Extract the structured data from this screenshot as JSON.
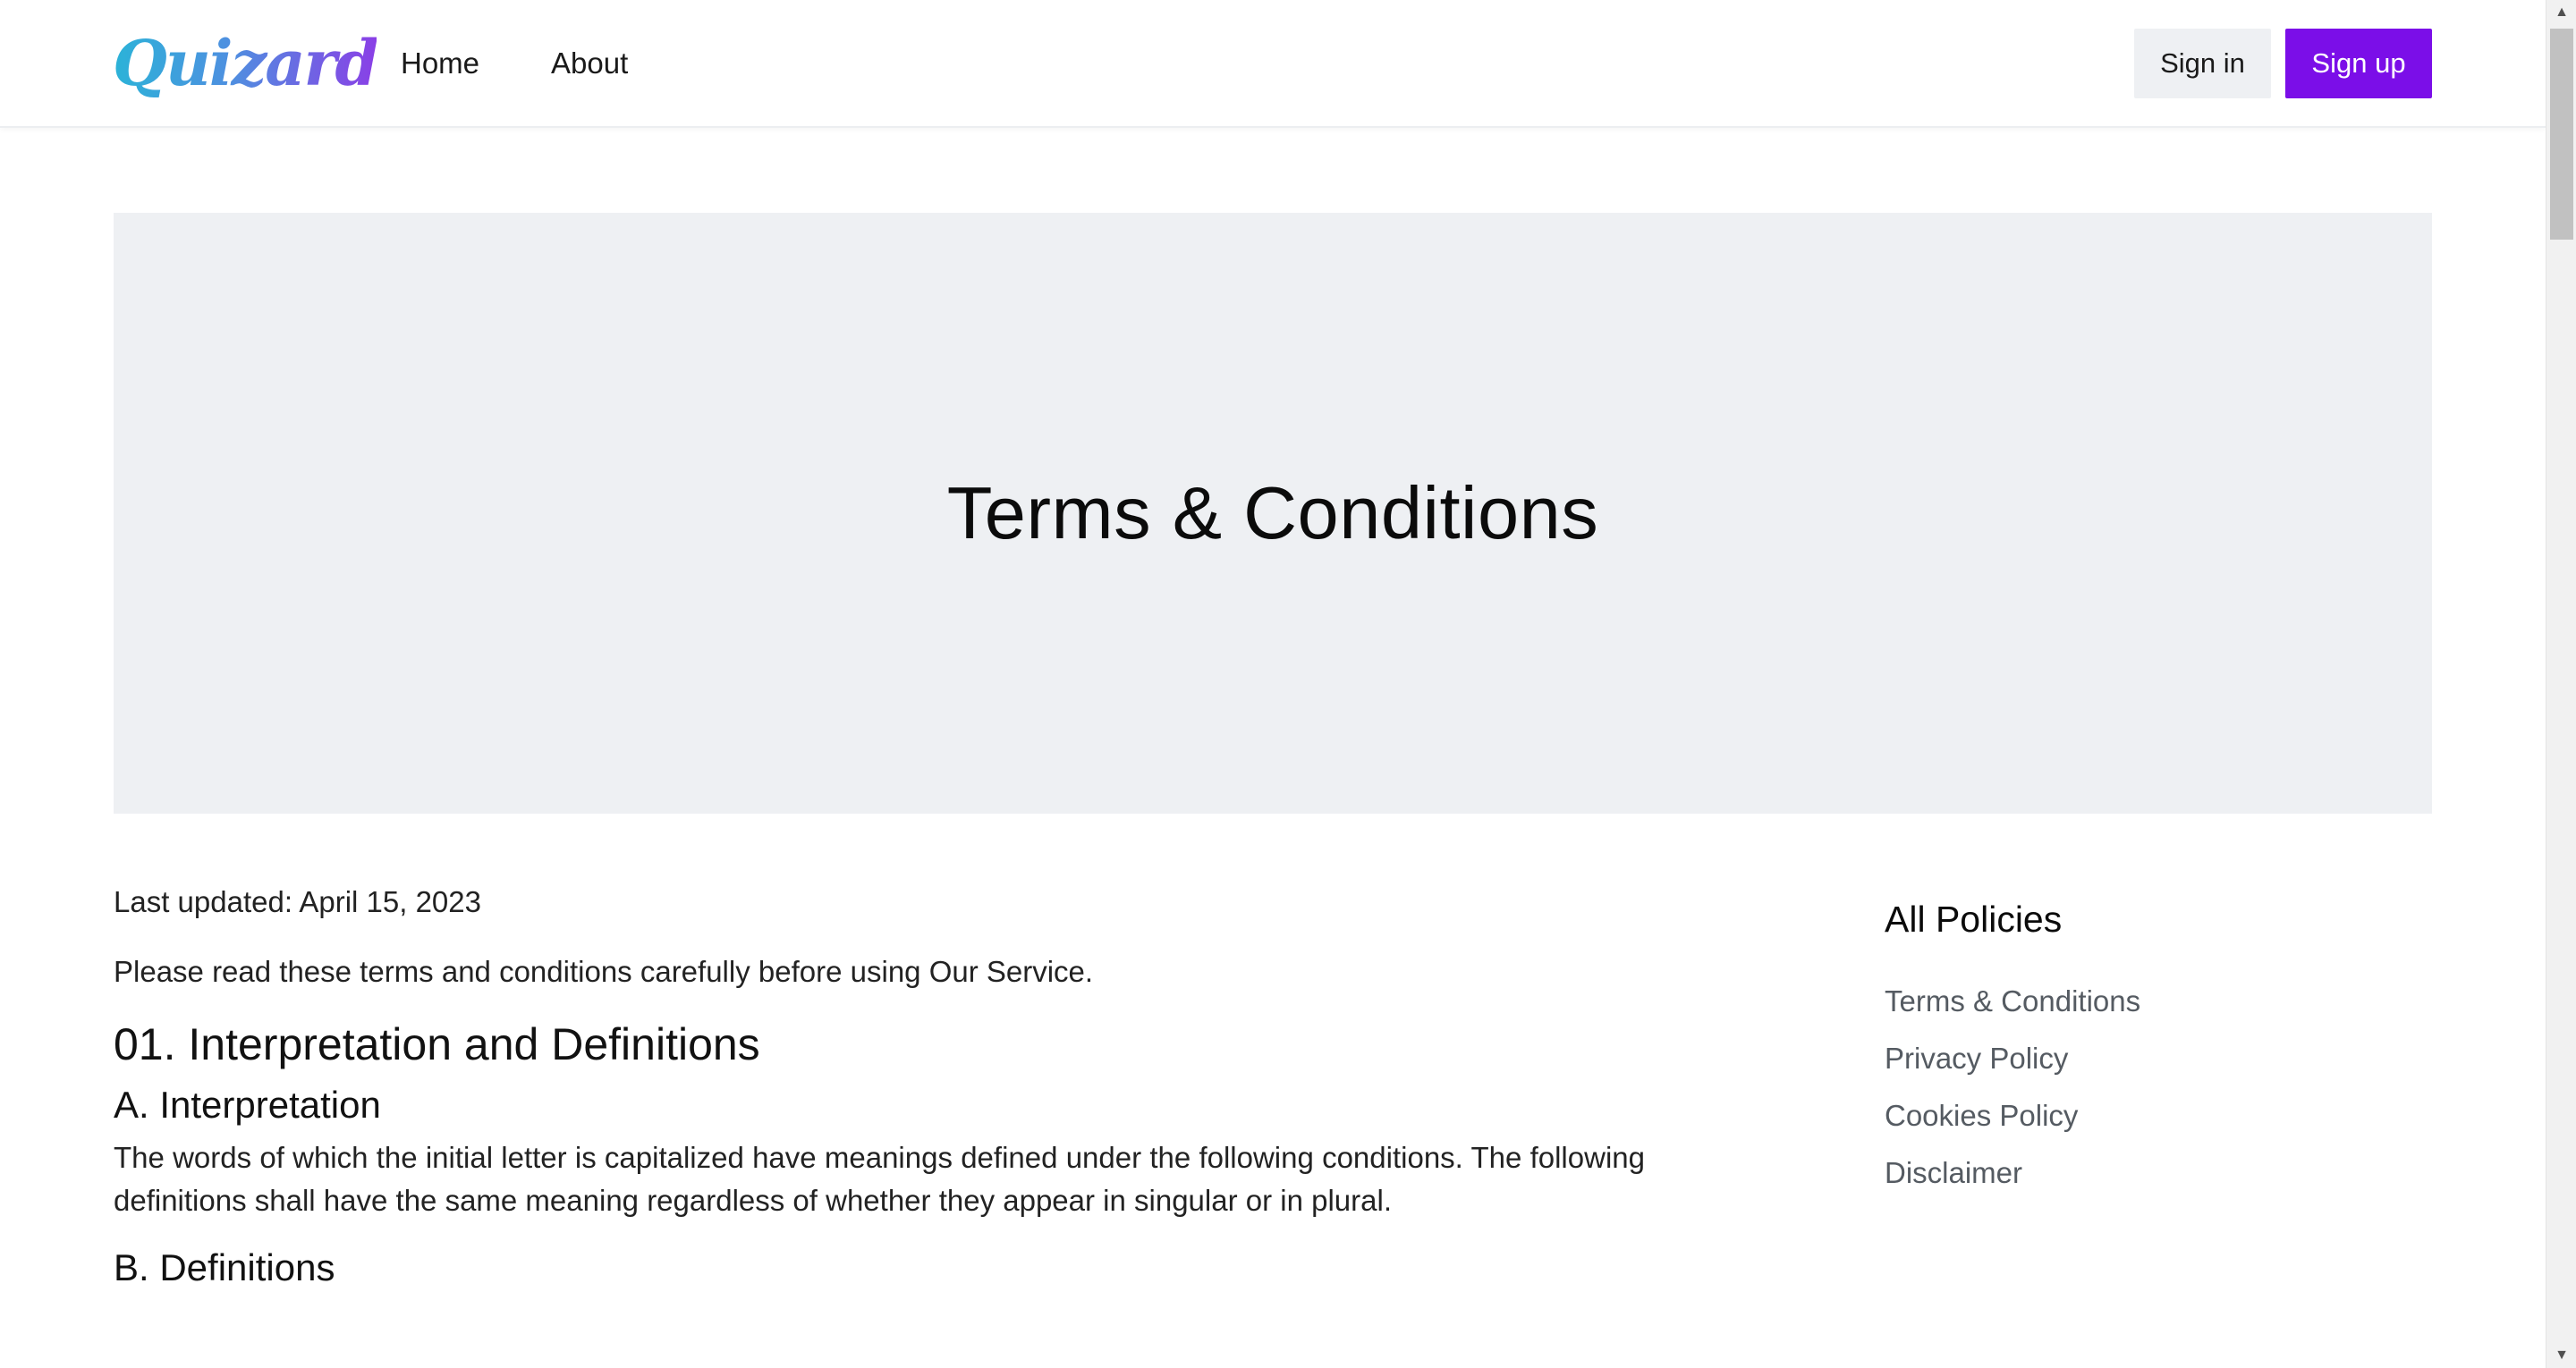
{
  "header": {
    "logo": "Quizard",
    "nav": [
      {
        "label": "Home"
      },
      {
        "label": "About"
      }
    ],
    "sign_in": "Sign in",
    "sign_up": "Sign up"
  },
  "hero": {
    "title": "Terms & Conditions"
  },
  "content": {
    "last_updated": "Last updated: April 15, 2023",
    "intro": "Please read these terms and conditions carefully before using Our Service.",
    "section_title": "01. Interpretation and Definitions",
    "sub_a_title": "A. Interpretation",
    "sub_a_text": "The words of which the initial letter is capitalized have meanings defined under the following conditions. The following definitions shall have the same meaning regardless of whether they appear in singular or in plural.",
    "sub_b_title": "B. Definitions"
  },
  "sidebar": {
    "title": "All Policies",
    "items": [
      {
        "label": "Terms & Conditions"
      },
      {
        "label": "Privacy Policy"
      },
      {
        "label": "Cookies Policy"
      },
      {
        "label": "Disclaimer"
      }
    ]
  },
  "colors": {
    "accent": "#7b0ee8",
    "hero_bg": "#eef0f3",
    "sign_in_bg": "#eef0f3",
    "link_text": "#555b62"
  },
  "icons": {
    "scroll_up": "scroll-up-arrow-icon",
    "scroll_down": "scroll-down-arrow-icon"
  }
}
